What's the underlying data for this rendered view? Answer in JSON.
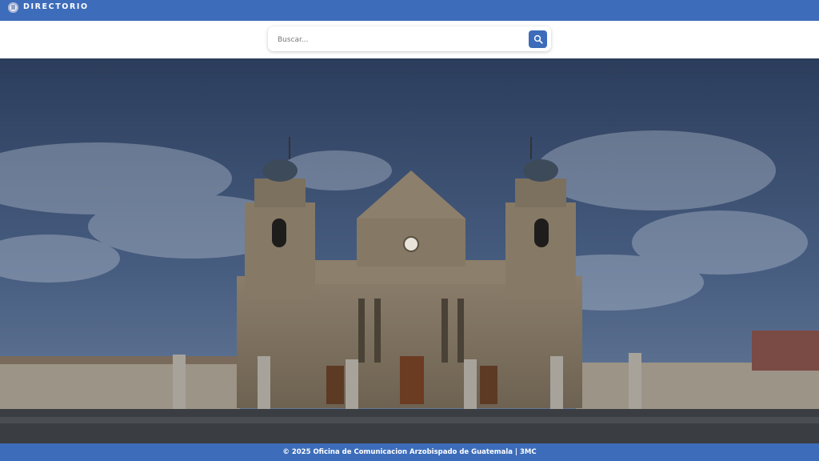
{
  "header": {
    "brand": "DIRECTORIO"
  },
  "search": {
    "placeholder": "Buscar..."
  },
  "hero": {
    "subject": "cathedral-photo"
  },
  "footer": {
    "text": "© 2025 Oficina de Comunicacion Arzobispado de Guatemala | 3MC"
  },
  "colors": {
    "primary": "#3d6dba",
    "background": "#ffffff"
  },
  "icons": {
    "brand": "crest-icon",
    "search": "search-icon"
  }
}
